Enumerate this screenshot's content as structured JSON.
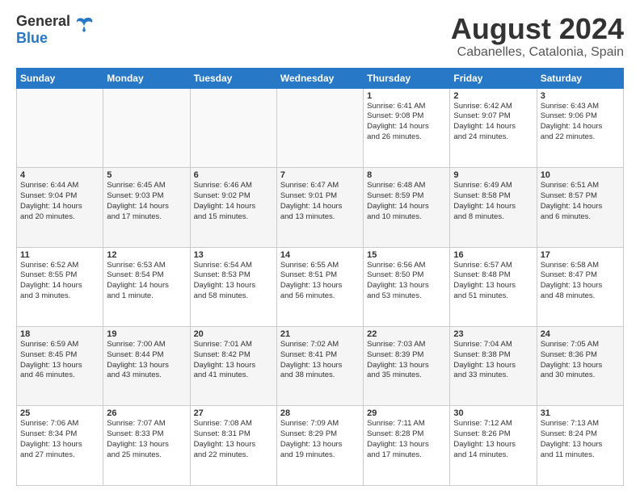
{
  "logo": {
    "general": "General",
    "blue": "Blue"
  },
  "title": "August 2024",
  "location": "Cabanelles, Catalonia, Spain",
  "headers": [
    "Sunday",
    "Monday",
    "Tuesday",
    "Wednesday",
    "Thursday",
    "Friday",
    "Saturday"
  ],
  "rows": [
    [
      {
        "day": "",
        "info": ""
      },
      {
        "day": "",
        "info": ""
      },
      {
        "day": "",
        "info": ""
      },
      {
        "day": "",
        "info": ""
      },
      {
        "day": "1",
        "info": "Sunrise: 6:41 AM\nSunset: 9:08 PM\nDaylight: 14 hours\nand 26 minutes."
      },
      {
        "day": "2",
        "info": "Sunrise: 6:42 AM\nSunset: 9:07 PM\nDaylight: 14 hours\nand 24 minutes."
      },
      {
        "day": "3",
        "info": "Sunrise: 6:43 AM\nSunset: 9:06 PM\nDaylight: 14 hours\nand 22 minutes."
      }
    ],
    [
      {
        "day": "4",
        "info": "Sunrise: 6:44 AM\nSunset: 9:04 PM\nDaylight: 14 hours\nand 20 minutes."
      },
      {
        "day": "5",
        "info": "Sunrise: 6:45 AM\nSunset: 9:03 PM\nDaylight: 14 hours\nand 17 minutes."
      },
      {
        "day": "6",
        "info": "Sunrise: 6:46 AM\nSunset: 9:02 PM\nDaylight: 14 hours\nand 15 minutes."
      },
      {
        "day": "7",
        "info": "Sunrise: 6:47 AM\nSunset: 9:01 PM\nDaylight: 14 hours\nand 13 minutes."
      },
      {
        "day": "8",
        "info": "Sunrise: 6:48 AM\nSunset: 8:59 PM\nDaylight: 14 hours\nand 10 minutes."
      },
      {
        "day": "9",
        "info": "Sunrise: 6:49 AM\nSunset: 8:58 PM\nDaylight: 14 hours\nand 8 minutes."
      },
      {
        "day": "10",
        "info": "Sunrise: 6:51 AM\nSunset: 8:57 PM\nDaylight: 14 hours\nand 6 minutes."
      }
    ],
    [
      {
        "day": "11",
        "info": "Sunrise: 6:52 AM\nSunset: 8:55 PM\nDaylight: 14 hours\nand 3 minutes."
      },
      {
        "day": "12",
        "info": "Sunrise: 6:53 AM\nSunset: 8:54 PM\nDaylight: 14 hours\nand 1 minute."
      },
      {
        "day": "13",
        "info": "Sunrise: 6:54 AM\nSunset: 8:53 PM\nDaylight: 13 hours\nand 58 minutes."
      },
      {
        "day": "14",
        "info": "Sunrise: 6:55 AM\nSunset: 8:51 PM\nDaylight: 13 hours\nand 56 minutes."
      },
      {
        "day": "15",
        "info": "Sunrise: 6:56 AM\nSunset: 8:50 PM\nDaylight: 13 hours\nand 53 minutes."
      },
      {
        "day": "16",
        "info": "Sunrise: 6:57 AM\nSunset: 8:48 PM\nDaylight: 13 hours\nand 51 minutes."
      },
      {
        "day": "17",
        "info": "Sunrise: 6:58 AM\nSunset: 8:47 PM\nDaylight: 13 hours\nand 48 minutes."
      }
    ],
    [
      {
        "day": "18",
        "info": "Sunrise: 6:59 AM\nSunset: 8:45 PM\nDaylight: 13 hours\nand 46 minutes."
      },
      {
        "day": "19",
        "info": "Sunrise: 7:00 AM\nSunset: 8:44 PM\nDaylight: 13 hours\nand 43 minutes."
      },
      {
        "day": "20",
        "info": "Sunrise: 7:01 AM\nSunset: 8:42 PM\nDaylight: 13 hours\nand 41 minutes."
      },
      {
        "day": "21",
        "info": "Sunrise: 7:02 AM\nSunset: 8:41 PM\nDaylight: 13 hours\nand 38 minutes."
      },
      {
        "day": "22",
        "info": "Sunrise: 7:03 AM\nSunset: 8:39 PM\nDaylight: 13 hours\nand 35 minutes."
      },
      {
        "day": "23",
        "info": "Sunrise: 7:04 AM\nSunset: 8:38 PM\nDaylight: 13 hours\nand 33 minutes."
      },
      {
        "day": "24",
        "info": "Sunrise: 7:05 AM\nSunset: 8:36 PM\nDaylight: 13 hours\nand 30 minutes."
      }
    ],
    [
      {
        "day": "25",
        "info": "Sunrise: 7:06 AM\nSunset: 8:34 PM\nDaylight: 13 hours\nand 27 minutes."
      },
      {
        "day": "26",
        "info": "Sunrise: 7:07 AM\nSunset: 8:33 PM\nDaylight: 13 hours\nand 25 minutes."
      },
      {
        "day": "27",
        "info": "Sunrise: 7:08 AM\nSunset: 8:31 PM\nDaylight: 13 hours\nand 22 minutes."
      },
      {
        "day": "28",
        "info": "Sunrise: 7:09 AM\nSunset: 8:29 PM\nDaylight: 13 hours\nand 19 minutes."
      },
      {
        "day": "29",
        "info": "Sunrise: 7:11 AM\nSunset: 8:28 PM\nDaylight: 13 hours\nand 17 minutes."
      },
      {
        "day": "30",
        "info": "Sunrise: 7:12 AM\nSunset: 8:26 PM\nDaylight: 13 hours\nand 14 minutes."
      },
      {
        "day": "31",
        "info": "Sunrise: 7:13 AM\nSunset: 8:24 PM\nDaylight: 13 hours\nand 11 minutes."
      }
    ]
  ]
}
